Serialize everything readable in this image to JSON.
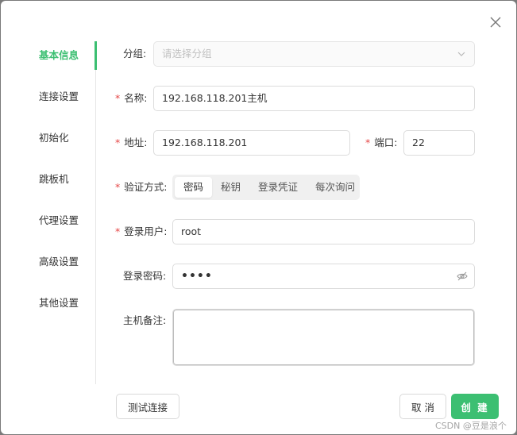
{
  "sidebar": {
    "items": [
      {
        "label": "基本信息",
        "active": true
      },
      {
        "label": "连接设置"
      },
      {
        "label": "初始化"
      },
      {
        "label": "跳板机"
      },
      {
        "label": "代理设置"
      },
      {
        "label": "高级设置"
      },
      {
        "label": "其他设置"
      }
    ]
  },
  "form": {
    "group": {
      "label": "分组:",
      "placeholder": "请选择分组"
    },
    "name": {
      "label": "名称:",
      "value": "192.168.118.201主机"
    },
    "address": {
      "label": "地址:",
      "value": "192.168.118.201"
    },
    "port": {
      "label": "端口:",
      "value": "22"
    },
    "auth": {
      "label": "验证方式:",
      "options": [
        "密码",
        "秘钥",
        "登录凭证",
        "每次询问"
      ],
      "selected": "密码"
    },
    "user": {
      "label": "登录用户:",
      "value": "root"
    },
    "password": {
      "label": "登录密码:",
      "masked_value": "••••"
    },
    "remark": {
      "label": "主机备注:",
      "value": ""
    },
    "required_mark": "*"
  },
  "footer": {
    "test_button": "测试连接",
    "cancel_button": "取 消",
    "create_button": "创 建"
  },
  "watermark": "CSDN @豆是浪个",
  "colors": {
    "accent": "#3cbf72",
    "required": "#e54545"
  }
}
